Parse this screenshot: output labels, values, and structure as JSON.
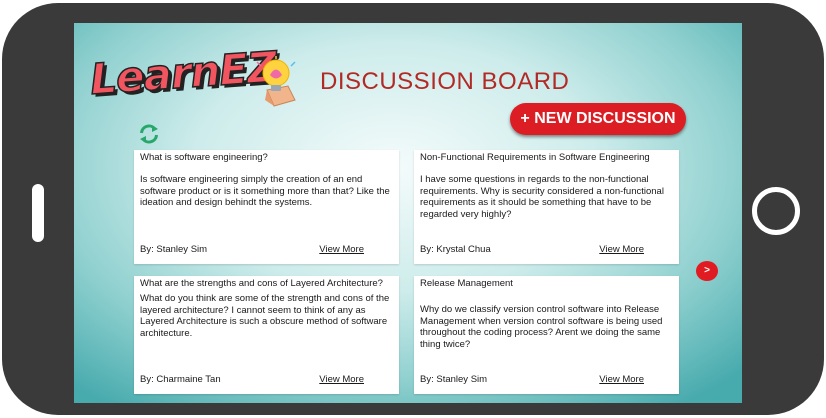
{
  "app": {
    "logo_text": "LearnEZ"
  },
  "header": {
    "title": "DISCUSSION BOARD",
    "new_discussion_label": "+ NEW DISCUSSION"
  },
  "icons": {
    "refresh": "refresh-icon",
    "next": "chevron-right-icon",
    "logo": "lightbulb-icon"
  },
  "colors": {
    "accent": "#dc1d23",
    "title": "#b22a26",
    "background_teal": "#47aaad"
  },
  "discussions": [
    {
      "title": "What is software engineering?",
      "body": "Is software engineering simply the creation of an end software product or is it something more than that? Like the ideation and design behindt the systems.",
      "author": "By: Stanley Sim",
      "link": "View More"
    },
    {
      "title": "Non-Functional Requirements in Software Engineering",
      "body": "I have some questions in regards to the non-functional requirements. Why is security considered a non-functional requirements as it should be something that have to be regarded very highly?",
      "author": "By: Krystal Chua",
      "link": "View More"
    },
    {
      "title": "What are the strengths and cons of Layered Architecture?",
      "body": "What do you think are some of the strength and cons of the layered architecture? I cannot seem to think of any as Layered Architecture is such a obscure method of software architecture.",
      "author": "By: Charmaine Tan",
      "link": "View More"
    },
    {
      "title": "Release Management",
      "body": "Why do we classify version control software into Release Management when version control software is being used throughout the coding process? Arent we doing the same thing twice?",
      "author": "By: Stanley Sim",
      "link": "View More"
    }
  ],
  "pagination": {
    "next_label": ">"
  }
}
